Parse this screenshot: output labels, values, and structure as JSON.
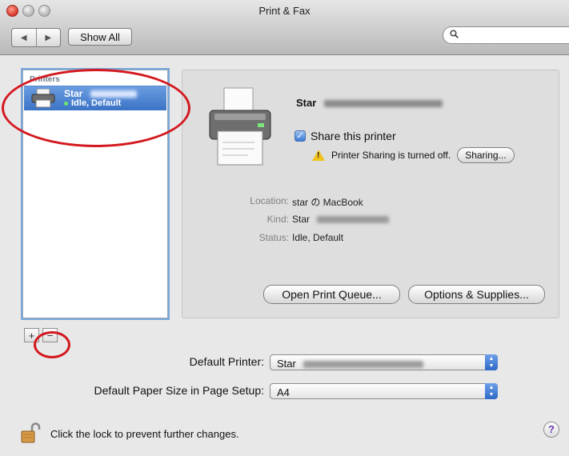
{
  "window": {
    "title": "Print & Fax"
  },
  "toolbar": {
    "back": "◀",
    "forward": "▶",
    "show_all": "Show All",
    "search_placeholder": ""
  },
  "list": {
    "header": "Printers",
    "items": [
      {
        "name": "Star",
        "status": "Idle, Default"
      }
    ]
  },
  "detail": {
    "printer_name": "Star",
    "share_label": "Share this printer",
    "share_checked": true,
    "sharing_off_text": "Printer Sharing is turned off.",
    "sharing_button": "Sharing...",
    "location_label": "Location:",
    "location_value": "star の MacBook",
    "kind_label": "Kind:",
    "kind_value": "Star",
    "status_label": "Status:",
    "status_value": "Idle, Default",
    "open_queue": "Open Print Queue...",
    "options_supplies": "Options & Supplies..."
  },
  "list_controls": {
    "add": "+",
    "remove": "−"
  },
  "defaults": {
    "printer_label": "Default Printer:",
    "printer_value": "Star",
    "paper_label": "Default Paper Size in Page Setup:",
    "paper_value": "A4"
  },
  "footer": {
    "lock_text": "Click the lock to prevent further changes.",
    "help": "?"
  },
  "colors": {
    "selection": "#3b74c6",
    "annotation": "#d4181f",
    "popup_arrow": "#2e68c7"
  }
}
